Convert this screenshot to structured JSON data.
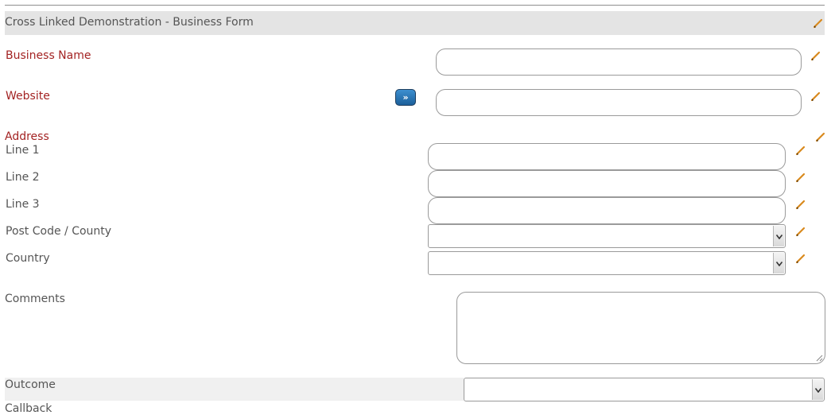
{
  "form": {
    "title": "Cross Linked Demonstration - Business Form",
    "business_name_label": "Business Name",
    "website_label": "Website",
    "website_button_glyph": "»",
    "address_label": "Address",
    "line1_label": "Line 1",
    "line2_label": "Line 2",
    "line3_label": "Line 3",
    "postcode_label": "Post Code / County",
    "country_label": "Country",
    "comments_label": "Comments",
    "outcome_label": "Outcome",
    "callback_label": "Callback"
  },
  "fields": {
    "business_name": "",
    "website": "",
    "line1": "",
    "line2": "",
    "line3": "",
    "postcode_county": "",
    "country": "",
    "comments": "",
    "outcome": ""
  },
  "colors": {
    "required_label": "#a32323",
    "edit_icon": "#d98a1e",
    "go_button": "#1b5f9a"
  },
  "icons": {
    "edit": "pencil-icon",
    "go": "double-chevron-right-icon",
    "dropdown": "chevron-down-icon"
  }
}
